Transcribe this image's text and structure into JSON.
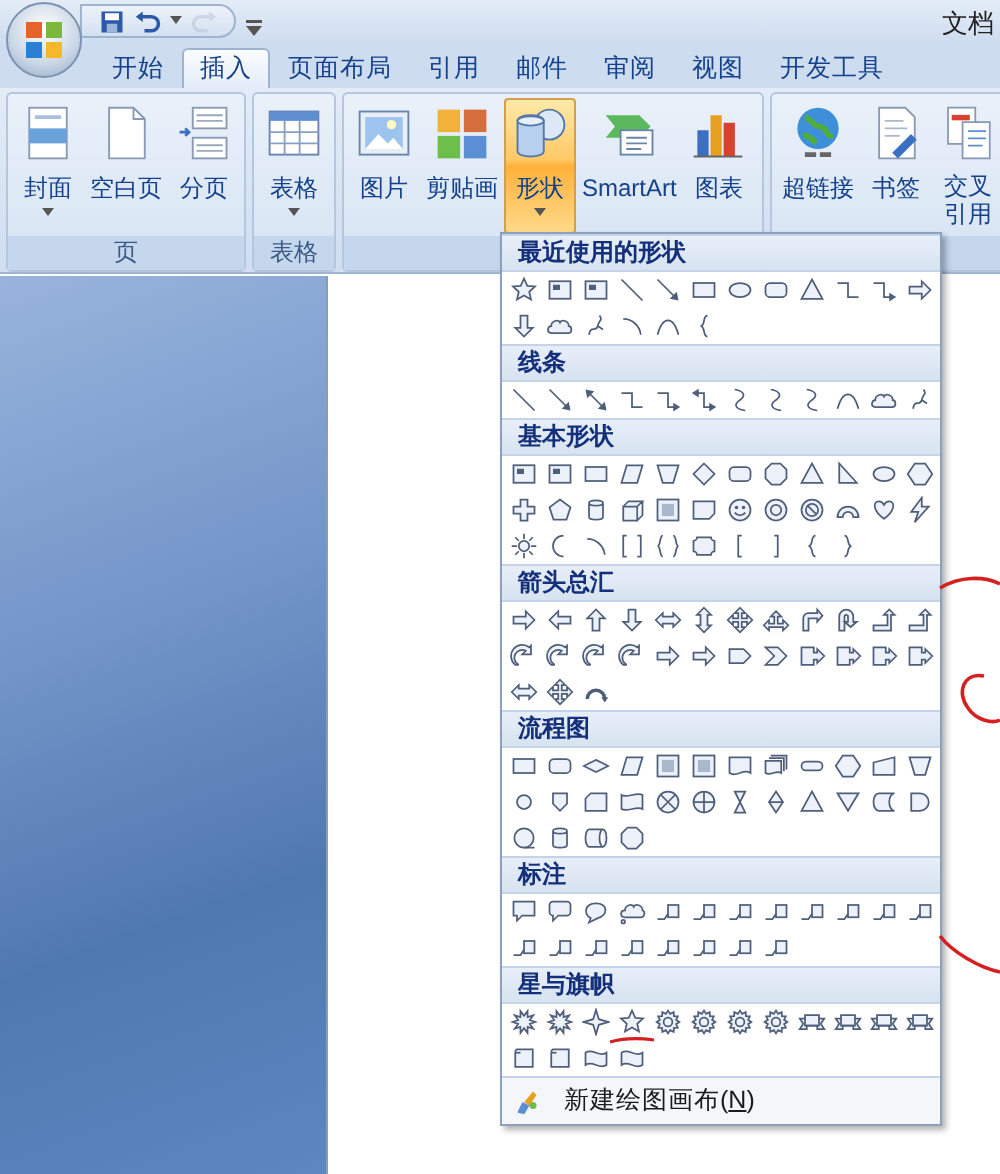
{
  "title_bar": {
    "title": "文档",
    "qat": [
      {
        "kind": "save",
        "disabled": false
      },
      {
        "kind": "undo",
        "disabled": false
      },
      {
        "kind": "redo",
        "disabled": true
      }
    ]
  },
  "tabs": [
    {
      "label": "开始",
      "selected": false
    },
    {
      "label": "插入",
      "selected": true
    },
    {
      "label": "页面布局",
      "selected": false
    },
    {
      "label": "引用",
      "selected": false
    },
    {
      "label": "邮件",
      "selected": false
    },
    {
      "label": "审阅",
      "selected": false
    },
    {
      "label": "视图",
      "selected": false
    },
    {
      "label": "开发工具",
      "selected": false
    }
  ],
  "ribbon_groups": [
    {
      "label": "页",
      "buttons": [
        {
          "kind": "cover",
          "label": "封面",
          "dropdown": true,
          "selected": false
        },
        {
          "kind": "blank",
          "label": "空白页",
          "dropdown": false,
          "selected": false
        },
        {
          "kind": "break",
          "label": "分页",
          "dropdown": false,
          "selected": false
        }
      ]
    },
    {
      "label": "表格",
      "buttons": [
        {
          "kind": "table",
          "label": "表格",
          "dropdown": true,
          "selected": false
        }
      ]
    },
    {
      "buttons": [
        {
          "kind": "picture",
          "label": "图片",
          "dropdown": false,
          "selected": false
        },
        {
          "kind": "clipart",
          "label": "剪贴画",
          "dropdown": false,
          "selected": false
        },
        {
          "kind": "shapes",
          "label": "形状",
          "dropdown": true,
          "selected": true
        },
        {
          "kind": "smartart",
          "label": "SmartArt",
          "dropdown": false,
          "selected": false
        },
        {
          "kind": "chart",
          "label": "图表",
          "dropdown": false,
          "selected": false
        }
      ]
    },
    {
      "buttons": [
        {
          "kind": "hyperlink",
          "label": "超链接",
          "dropdown": false,
          "selected": false
        },
        {
          "kind": "bookmark",
          "label": "书签",
          "dropdown": false,
          "selected": false
        },
        {
          "kind": "crossref",
          "label": "交叉引用",
          "dropdown": false,
          "selected": false
        }
      ]
    }
  ],
  "shapes_menu": {
    "sections": [
      {
        "title": "最近使用的形状",
        "shapes": [
          {
            "kind": "star"
          },
          {
            "kind": "textbox"
          },
          {
            "kind": "textbox"
          },
          {
            "kind": "line"
          },
          {
            "kind": "arrow-line"
          },
          {
            "kind": "rect"
          },
          {
            "kind": "oval"
          },
          {
            "kind": "rounded-rect"
          },
          {
            "kind": "triangle"
          },
          {
            "kind": "elbow"
          },
          {
            "kind": "elbow-arrow"
          },
          {
            "kind": "arrow-right"
          },
          {
            "kind": "arrow-down"
          },
          {
            "kind": "cloud"
          },
          {
            "kind": "scribble"
          },
          {
            "kind": "arc"
          },
          {
            "kind": "curve"
          },
          {
            "kind": "brace-left"
          }
        ]
      },
      {
        "title": "线条",
        "shapes": [
          {
            "kind": "line"
          },
          {
            "kind": "arrow-line"
          },
          {
            "kind": "double-arrow-line"
          },
          {
            "kind": "elbow"
          },
          {
            "kind": "elbow-arrow"
          },
          {
            "kind": "elbow-double"
          },
          {
            "kind": "s-curve"
          },
          {
            "kind": "s-curve"
          },
          {
            "kind": "s-curve"
          },
          {
            "kind": "curve"
          },
          {
            "kind": "cloud"
          },
          {
            "kind": "scribble"
          }
        ]
      },
      {
        "title": "基本形状",
        "shapes": [
          {
            "kind": "textbox"
          },
          {
            "kind": "textbox"
          },
          {
            "kind": "rect"
          },
          {
            "kind": "parallelogram"
          },
          {
            "kind": "trapezoid"
          },
          {
            "kind": "diamond"
          },
          {
            "kind": "rounded-rect"
          },
          {
            "kind": "octagon"
          },
          {
            "kind": "triangle"
          },
          {
            "kind": "right-triangle"
          },
          {
            "kind": "oval"
          },
          {
            "kind": "hexagon"
          },
          {
            "kind": "cross"
          },
          {
            "kind": "pentagon"
          },
          {
            "kind": "can"
          },
          {
            "kind": "cube"
          },
          {
            "kind": "bevel"
          },
          {
            "kind": "folded"
          },
          {
            "kind": "smiley"
          },
          {
            "kind": "donut"
          },
          {
            "kind": "no-symbol"
          },
          {
            "kind": "block-arc"
          },
          {
            "kind": "heart"
          },
          {
            "kind": "lightning"
          },
          {
            "kind": "sun"
          },
          {
            "kind": "moon"
          },
          {
            "kind": "arc"
          },
          {
            "kind": "bracket-pair"
          },
          {
            "kind": "brace-pair"
          },
          {
            "kind": "plaque"
          },
          {
            "kind": "bracket-left"
          },
          {
            "kind": "bracket-right"
          },
          {
            "kind": "brace-left"
          },
          {
            "kind": "brace-right"
          }
        ]
      },
      {
        "title": "箭头总汇",
        "shapes": [
          {
            "kind": "arrow-right"
          },
          {
            "kind": "arrow-left"
          },
          {
            "kind": "arrow-up"
          },
          {
            "kind": "arrow-down"
          },
          {
            "kind": "arrow-lr"
          },
          {
            "kind": "arrow-ud"
          },
          {
            "kind": "arrow-quad"
          },
          {
            "kind": "arrow-lru"
          },
          {
            "kind": "bent-arrow"
          },
          {
            "kind": "u-turn"
          },
          {
            "kind": "bent-up"
          },
          {
            "kind": "bent-up"
          },
          {
            "kind": "curved-arrow"
          },
          {
            "kind": "curved-arrow"
          },
          {
            "kind": "curved-arrow"
          },
          {
            "kind": "curved-arrow"
          },
          {
            "kind": "arrow-right"
          },
          {
            "kind": "arrow-right"
          },
          {
            "kind": "pentagon-arrow"
          },
          {
            "kind": "chevron"
          },
          {
            "kind": "callout-arrow"
          },
          {
            "kind": "callout-arrow"
          },
          {
            "kind": "callout-arrow"
          },
          {
            "kind": "callout-arrow"
          },
          {
            "kind": "arrow-lr"
          },
          {
            "kind": "arrow-quad"
          },
          {
            "kind": "circular-arrow"
          }
        ]
      },
      {
        "title": "流程图",
        "shapes": [
          {
            "kind": "rect"
          },
          {
            "kind": "rounded-rect"
          },
          {
            "kind": "diamond-flat"
          },
          {
            "kind": "parallelogram"
          },
          {
            "kind": "bevel"
          },
          {
            "kind": "bevel"
          },
          {
            "kind": "document"
          },
          {
            "kind": "multidoc"
          },
          {
            "kind": "terminator"
          },
          {
            "kind": "hexagon"
          },
          {
            "kind": "manual-input"
          },
          {
            "kind": "trapezoid"
          },
          {
            "kind": "circle"
          },
          {
            "kind": "offpage"
          },
          {
            "kind": "card"
          },
          {
            "kind": "punched-tape"
          },
          {
            "kind": "summing"
          },
          {
            "kind": "or"
          },
          {
            "kind": "collate"
          },
          {
            "kind": "sort"
          },
          {
            "kind": "triangle"
          },
          {
            "kind": "merge"
          },
          {
            "kind": "stored-data"
          },
          {
            "kind": "delay"
          },
          {
            "kind": "sequential"
          },
          {
            "kind": "can"
          },
          {
            "kind": "direct-access"
          },
          {
            "kind": "octagon"
          }
        ]
      },
      {
        "title": "标注",
        "shapes": [
          {
            "kind": "callout-rect"
          },
          {
            "kind": "callout-round"
          },
          {
            "kind": "callout-oval"
          },
          {
            "kind": "callout-cloud"
          },
          {
            "kind": "line-callout"
          },
          {
            "kind": "line-callout"
          },
          {
            "kind": "line-callout"
          },
          {
            "kind": "line-callout"
          },
          {
            "kind": "line-callout"
          },
          {
            "kind": "line-callout"
          },
          {
            "kind": "line-callout"
          },
          {
            "kind": "line-callout"
          },
          {
            "kind": "line-callout"
          },
          {
            "kind": "line-callout"
          },
          {
            "kind": "line-callout"
          },
          {
            "kind": "line-callout"
          },
          {
            "kind": "line-callout"
          },
          {
            "kind": "line-callout"
          },
          {
            "kind": "line-callout"
          },
          {
            "kind": "line-callout"
          }
        ]
      },
      {
        "title": "星与旗帜",
        "shapes": [
          {
            "kind": "burst"
          },
          {
            "kind": "burst"
          },
          {
            "kind": "star4"
          },
          {
            "kind": "star"
          },
          {
            "kind": "seal"
          },
          {
            "kind": "seal"
          },
          {
            "kind": "seal"
          },
          {
            "kind": "seal"
          },
          {
            "kind": "ribbon"
          },
          {
            "kind": "ribbon"
          },
          {
            "kind": "ribbon"
          },
          {
            "kind": "ribbon"
          },
          {
            "kind": "scroll"
          },
          {
            "kind": "scroll"
          },
          {
            "kind": "wave"
          },
          {
            "kind": "wave"
          }
        ]
      }
    ],
    "footer": {
      "label_before": "新建绘图画布(",
      "access_key": "N",
      "label_after": ")"
    }
  }
}
